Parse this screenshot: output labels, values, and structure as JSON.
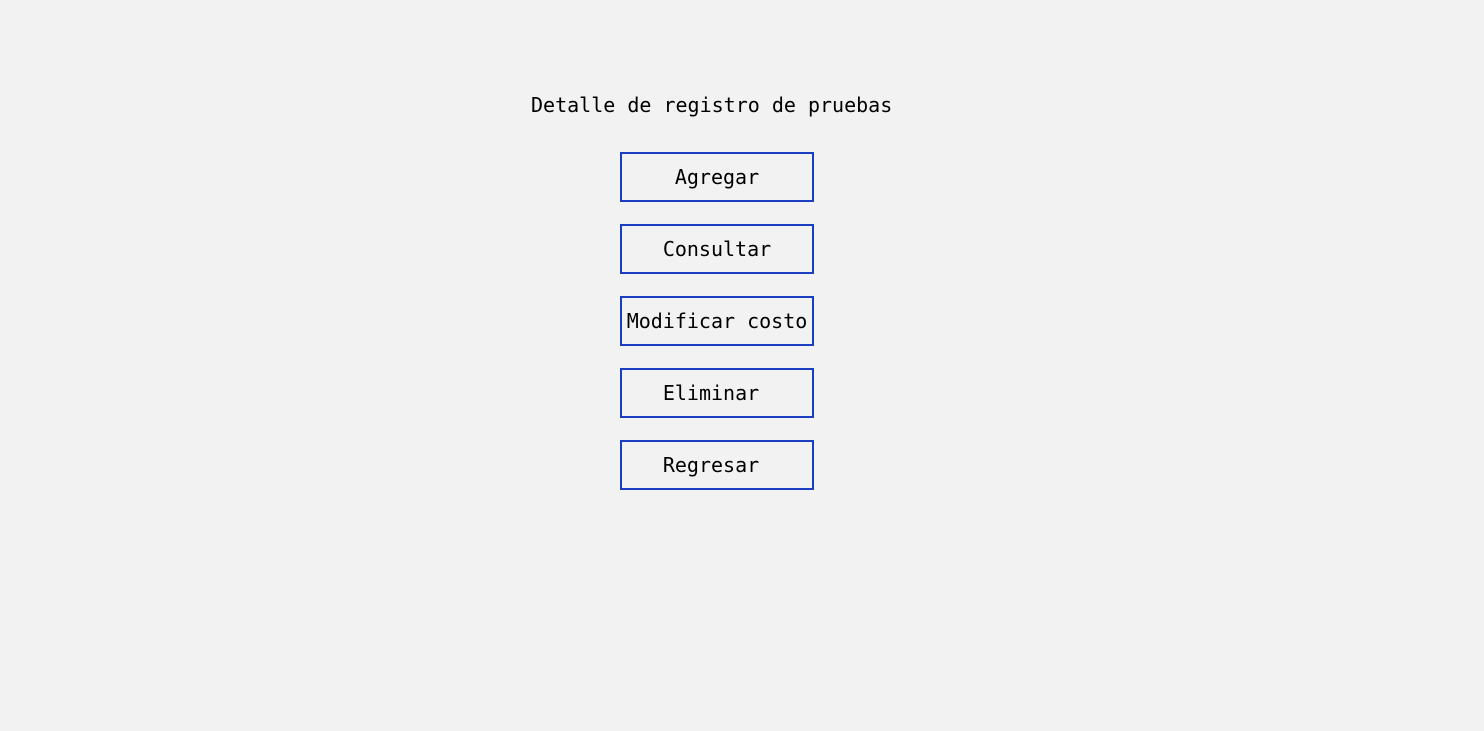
{
  "header": {
    "title": "Detalle de registro de pruebas"
  },
  "menu": {
    "buttons": [
      {
        "label": "Agregar"
      },
      {
        "label": "Consultar"
      },
      {
        "label": "Modificar costo"
      },
      {
        "label": "Eliminar"
      },
      {
        "label": "Regresar"
      }
    ]
  },
  "colors": {
    "background": "#f2f2f2",
    "button_border": "#1a3ec0",
    "text": "#000000"
  }
}
